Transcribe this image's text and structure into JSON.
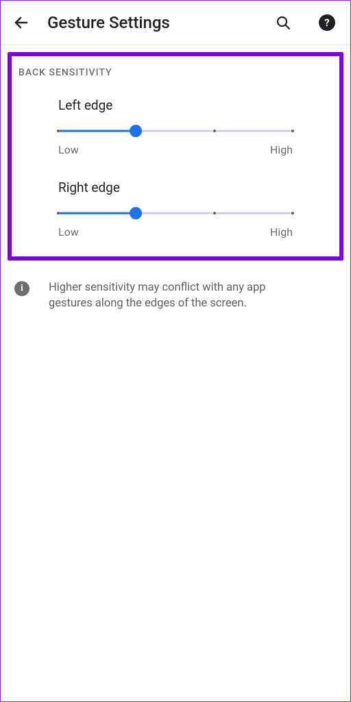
{
  "header": {
    "title": "Gesture Settings"
  },
  "section_label": "BACK SENSITIVITY",
  "sliders": {
    "left": {
      "title": "Left edge",
      "low_label": "Low",
      "high_label": "High",
      "value_pct": 33
    },
    "right": {
      "title": "Right edge",
      "low_label": "Low",
      "high_label": "High",
      "value_pct": 33
    }
  },
  "info_text": "Higher sensitivity may conflict with any app gestures along the edges of the screen.",
  "colors": {
    "accent": "#1a73e8",
    "highlight_border": "#8000d7"
  }
}
